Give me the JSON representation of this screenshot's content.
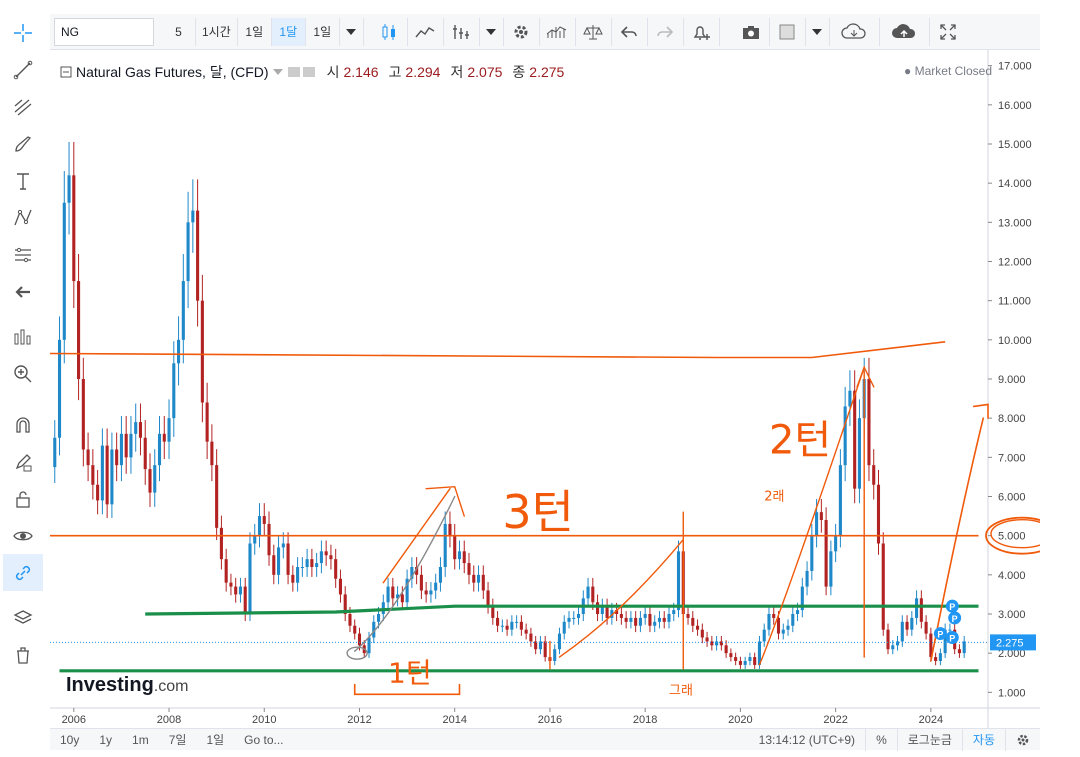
{
  "toolbar": {
    "symbol": "NG",
    "intervals": [
      "5",
      "1시간",
      "1일",
      "1달",
      "1일"
    ],
    "active_interval": 3
  },
  "legend": {
    "name": "Natural Gas Futures, 달, (CFD)",
    "open_label": "시",
    "open": "2.146",
    "high_label": "고",
    "high": "2.294",
    "low_label": "저",
    "low": "2.075",
    "close_label": "종",
    "close": "2.275",
    "status": "Market Closed"
  },
  "logo": {
    "main": "Investing",
    "suffix": ".com"
  },
  "bottom": {
    "ranges": [
      "10y",
      "1y",
      "1m",
      "7일",
      "1일",
      "Go to..."
    ],
    "time": "13:14:12 (UTC+9)",
    "percent": "%",
    "log": "로그눈금",
    "auto": "자동"
  },
  "annotations": {
    "text_3": "3턴",
    "text_2": "2턴",
    "text_1": "1턴",
    "text_small1": "그래",
    "text_small2": "2래"
  },
  "colors": {
    "up": "#1e88c9",
    "down": "#b22222",
    "orange": "#f05a0a",
    "green": "#1a8f4a",
    "price_label": "#2196f3",
    "marker": "#2196f3"
  },
  "chart_data": {
    "type": "candlestick",
    "x_labels": [
      "2006",
      "2008",
      "2010",
      "2012",
      "2014",
      "2016",
      "2018",
      "2020",
      "2022",
      "2024"
    ],
    "y_ticks": [
      "1.000",
      "2.000",
      "3.000",
      "4.000",
      "5.000",
      "6.000",
      "7.000",
      "8.000",
      "9.000",
      "10.000",
      "11.000",
      "12.000",
      "13.000",
      "14.000",
      "15.000",
      "16.000",
      "17.000"
    ],
    "ylim": [
      0.6,
      17.4
    ],
    "xlim": [
      2005.5,
      2025.2
    ],
    "current_price": "2.275",
    "series_close": [
      [
        2005.6,
        7.5
      ],
      [
        2005.7,
        10.0
      ],
      [
        2005.8,
        13.5
      ],
      [
        2005.9,
        14.2
      ],
      [
        2006.0,
        11.5
      ],
      [
        2006.1,
        9.0
      ],
      [
        2006.2,
        7.2
      ],
      [
        2006.3,
        6.8
      ],
      [
        2006.4,
        6.3
      ],
      [
        2006.5,
        5.9
      ],
      [
        2006.6,
        7.3
      ],
      [
        2006.7,
        5.8
      ],
      [
        2006.8,
        7.2
      ],
      [
        2006.9,
        6.8
      ],
      [
        2007.0,
        7.6
      ],
      [
        2007.1,
        7.0
      ],
      [
        2007.2,
        7.6
      ],
      [
        2007.3,
        7.9
      ],
      [
        2007.4,
        7.5
      ],
      [
        2007.5,
        6.7
      ],
      [
        2007.6,
        6.1
      ],
      [
        2007.7,
        6.8
      ],
      [
        2007.8,
        7.6
      ],
      [
        2007.9,
        7.4
      ],
      [
        2008.0,
        8.0
      ],
      [
        2008.1,
        9.4
      ],
      [
        2008.2,
        10.0
      ],
      [
        2008.3,
        11.5
      ],
      [
        2008.4,
        13.0
      ],
      [
        2008.5,
        13.3
      ],
      [
        2008.6,
        11.0
      ],
      [
        2008.7,
        8.4
      ],
      [
        2008.8,
        7.4
      ],
      [
        2008.9,
        6.8
      ],
      [
        2009.0,
        5.2
      ],
      [
        2009.1,
        4.4
      ],
      [
        2009.2,
        3.8
      ],
      [
        2009.3,
        3.7
      ],
      [
        2009.4,
        3.5
      ],
      [
        2009.5,
        3.7
      ],
      [
        2009.6,
        3.0
      ],
      [
        2009.7,
        4.8
      ],
      [
        2009.8,
        5.0
      ],
      [
        2009.9,
        5.5
      ],
      [
        2010.0,
        5.3
      ],
      [
        2010.1,
        4.5
      ],
      [
        2010.2,
        4.0
      ],
      [
        2010.3,
        4.7
      ],
      [
        2010.4,
        4.8
      ],
      [
        2010.5,
        4.0
      ],
      [
        2010.6,
        3.8
      ],
      [
        2010.7,
        4.2
      ],
      [
        2010.8,
        4.2
      ],
      [
        2010.9,
        4.4
      ],
      [
        2011.0,
        4.2
      ],
      [
        2011.1,
        4.3
      ],
      [
        2011.2,
        4.6
      ],
      [
        2011.3,
        4.5
      ],
      [
        2011.4,
        4.4
      ],
      [
        2011.5,
        3.9
      ],
      [
        2011.6,
        3.5
      ],
      [
        2011.7,
        3.0
      ],
      [
        2011.8,
        2.7
      ],
      [
        2011.9,
        2.5
      ],
      [
        2012.0,
        2.2
      ],
      [
        2012.1,
        2.0
      ],
      [
        2012.2,
        2.4
      ],
      [
        2012.3,
        2.8
      ],
      [
        2012.4,
        3.0
      ],
      [
        2012.5,
        3.3
      ],
      [
        2012.6,
        3.7
      ],
      [
        2012.7,
        3.4
      ],
      [
        2012.8,
        3.5
      ],
      [
        2012.9,
        3.3
      ],
      [
        2013.0,
        3.9
      ],
      [
        2013.1,
        4.2
      ],
      [
        2013.2,
        4.0
      ],
      [
        2013.3,
        3.6
      ],
      [
        2013.4,
        3.5
      ],
      [
        2013.5,
        3.6
      ],
      [
        2013.6,
        3.8
      ],
      [
        2013.7,
        4.2
      ],
      [
        2013.8,
        5.3
      ],
      [
        2013.9,
        5.0
      ],
      [
        2014.0,
        4.4
      ],
      [
        2014.1,
        4.6
      ],
      [
        2014.2,
        4.3
      ],
      [
        2014.3,
        4.0
      ],
      [
        2014.4,
        3.8
      ],
      [
        2014.5,
        4.0
      ],
      [
        2014.6,
        3.6
      ],
      [
        2014.7,
        3.2
      ],
      [
        2014.8,
        2.9
      ],
      [
        2014.9,
        2.7
      ],
      [
        2015.0,
        2.7
      ],
      [
        2015.1,
        2.6
      ],
      [
        2015.2,
        2.8
      ],
      [
        2015.3,
        2.8
      ],
      [
        2015.4,
        2.6
      ],
      [
        2015.5,
        2.5
      ],
      [
        2015.6,
        2.3
      ],
      [
        2015.7,
        2.1
      ],
      [
        2015.8,
        2.3
      ],
      [
        2015.9,
        1.9
      ],
      [
        2016.0,
        1.8
      ],
      [
        2016.1,
        2.1
      ],
      [
        2016.2,
        2.5
      ],
      [
        2016.3,
        2.8
      ],
      [
        2016.4,
        2.9
      ],
      [
        2016.5,
        2.9
      ],
      [
        2016.6,
        3.0
      ],
      [
        2016.7,
        3.4
      ],
      [
        2016.8,
        3.7
      ],
      [
        2016.9,
        3.3
      ],
      [
        2017.0,
        3.0
      ],
      [
        2017.1,
        3.2
      ],
      [
        2017.2,
        2.9
      ],
      [
        2017.3,
        3.1
      ],
      [
        2017.4,
        3.0
      ],
      [
        2017.5,
        2.9
      ],
      [
        2017.6,
        2.8
      ],
      [
        2017.7,
        2.9
      ],
      [
        2017.8,
        2.7
      ],
      [
        2017.9,
        2.9
      ],
      [
        2018.0,
        3.0
      ],
      [
        2018.1,
        2.7
      ],
      [
        2018.2,
        2.8
      ],
      [
        2018.3,
        2.9
      ],
      [
        2018.4,
        2.8
      ],
      [
        2018.5,
        3.0
      ],
      [
        2018.6,
        3.1
      ],
      [
        2018.7,
        4.6
      ],
      [
        2018.8,
        3.0
      ],
      [
        2018.9,
        2.9
      ],
      [
        2019.0,
        2.7
      ],
      [
        2019.1,
        2.6
      ],
      [
        2019.2,
        2.4
      ],
      [
        2019.3,
        2.3
      ],
      [
        2019.4,
        2.2
      ],
      [
        2019.5,
        2.3
      ],
      [
        2019.6,
        2.2
      ],
      [
        2019.7,
        2.0
      ],
      [
        2019.8,
        1.9
      ],
      [
        2019.9,
        1.8
      ],
      [
        2020.0,
        1.7
      ],
      [
        2020.1,
        1.8
      ],
      [
        2020.2,
        1.9
      ],
      [
        2020.3,
        1.7
      ],
      [
        2020.4,
        2.3
      ],
      [
        2020.5,
        2.6
      ],
      [
        2020.6,
        3.0
      ],
      [
        2020.7,
        2.9
      ],
      [
        2020.8,
        2.5
      ],
      [
        2020.9,
        2.6
      ],
      [
        2021.0,
        2.7
      ],
      [
        2021.1,
        3.0
      ],
      [
        2021.2,
        3.1
      ],
      [
        2021.3,
        3.7
      ],
      [
        2021.4,
        4.1
      ],
      [
        2021.5,
        5.0
      ],
      [
        2021.6,
        5.6
      ],
      [
        2021.7,
        5.4
      ],
      [
        2021.8,
        3.7
      ],
      [
        2021.9,
        4.6
      ],
      [
        2022.0,
        5.0
      ],
      [
        2022.1,
        6.8
      ],
      [
        2022.2,
        8.3
      ],
      [
        2022.3,
        8.7
      ],
      [
        2022.4,
        6.2
      ],
      [
        2022.5,
        8.0
      ],
      [
        2022.6,
        9.0
      ],
      [
        2022.7,
        6.8
      ],
      [
        2022.8,
        6.3
      ],
      [
        2022.9,
        4.8
      ],
      [
        2023.0,
        2.6
      ],
      [
        2023.1,
        2.1
      ],
      [
        2023.2,
        2.2
      ],
      [
        2023.3,
        2.3
      ],
      [
        2023.4,
        2.8
      ],
      [
        2023.5,
        2.6
      ],
      [
        2023.6,
        2.9
      ],
      [
        2023.7,
        3.4
      ],
      [
        2023.8,
        2.8
      ],
      [
        2023.9,
        2.5
      ],
      [
        2024.0,
        1.9
      ],
      [
        2024.1,
        1.8
      ],
      [
        2024.2,
        2.0
      ],
      [
        2024.3,
        2.6
      ],
      [
        2024.4,
        2.6
      ],
      [
        2024.5,
        2.1
      ],
      [
        2024.6,
        2.0
      ],
      [
        2024.7,
        2.3
      ]
    ],
    "horizontal_lines": [
      {
        "color": "orange",
        "points": [
          [
            2005.5,
            9.65
          ],
          [
            2019.5,
            9.55
          ],
          [
            2021.5,
            9.55
          ],
          [
            2024.3,
            9.95
          ]
        ]
      },
      {
        "color": "orange",
        "points": [
          [
            2005.4,
            5.0
          ],
          [
            2025.0,
            5.0
          ]
        ]
      },
      {
        "color": "green",
        "points": [
          [
            2007.5,
            3.0
          ],
          [
            2011.5,
            3.05
          ],
          [
            2014.0,
            3.2
          ],
          [
            2025.0,
            3.2
          ]
        ]
      },
      {
        "color": "green",
        "points": [
          [
            2005.7,
            1.55
          ],
          [
            2025.0,
            1.55
          ]
        ]
      }
    ]
  }
}
